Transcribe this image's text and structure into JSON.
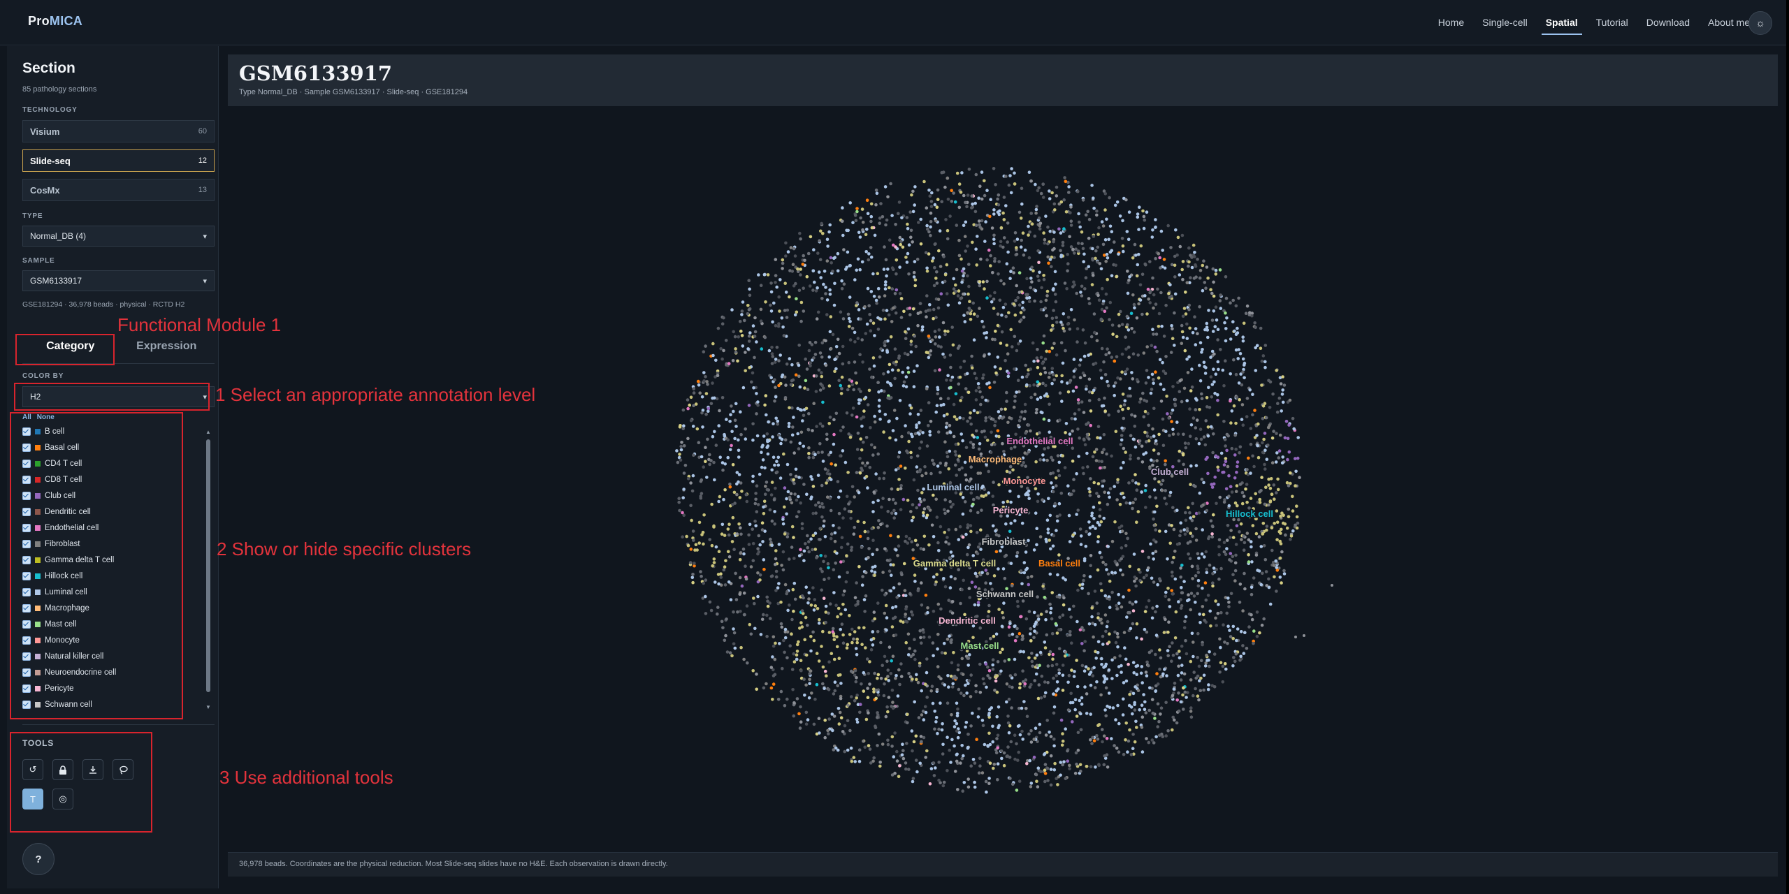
{
  "nav": {
    "brand_part1": "Pro",
    "brand_part2": "MICA",
    "links": [
      "Home",
      "Single-cell",
      "Spatial",
      "Tutorial",
      "Download",
      "About me"
    ],
    "active": "Spatial",
    "theme_icon": "sun-icon"
  },
  "sidebar": {
    "title": "Section",
    "subtitle": "85 pathology sections",
    "technology_label": "TECHNOLOGY",
    "technologies": [
      {
        "name": "Visium",
        "count": "60"
      },
      {
        "name": "Slide-seq",
        "count": "12"
      },
      {
        "name": "CosMx",
        "count": "13"
      }
    ],
    "selected_technology": "Slide-seq",
    "type_label": "TYPE",
    "type_value": "Normal_DB (4)",
    "sample_label": "SAMPLE",
    "sample_value": "GSM6133917",
    "meta": "GSE181294 · 36,978 beads · physical · RCTD H2",
    "tabs": [
      "Category",
      "Expression"
    ],
    "active_tab": "Category",
    "color_by_label": "COLOR BY",
    "color_by_value": "H2",
    "all_label": "All",
    "none_label": "None",
    "clusters": [
      {
        "name": "B cell",
        "color": "#1f77b4"
      },
      {
        "name": "Basal cell",
        "color": "#ff7f0e"
      },
      {
        "name": "CD4 T cell",
        "color": "#2ca02c"
      },
      {
        "name": "CD8 T cell",
        "color": "#d62728"
      },
      {
        "name": "Club cell",
        "color": "#9467bd"
      },
      {
        "name": "Dendritic cell",
        "color": "#8c564b"
      },
      {
        "name": "Endothelial cell",
        "color": "#e377c2"
      },
      {
        "name": "Fibroblast",
        "color": "#7f7f7f"
      },
      {
        "name": "Gamma delta T cell",
        "color": "#bcbd22"
      },
      {
        "name": "Hillock cell",
        "color": "#17becf"
      },
      {
        "name": "Luminal cell",
        "color": "#aec7e8"
      },
      {
        "name": "Macrophage",
        "color": "#ffbb78"
      },
      {
        "name": "Mast cell",
        "color": "#98df8a"
      },
      {
        "name": "Monocyte",
        "color": "#ff9896"
      },
      {
        "name": "Natural killer cell",
        "color": "#c5b0d5"
      },
      {
        "name": "Neuroendocrine cell",
        "color": "#c49c94"
      },
      {
        "name": "Pericyte",
        "color": "#f7b6d2"
      },
      {
        "name": "Schwann cell",
        "color": "#c7c7c7"
      }
    ],
    "tools_label": "TOOLS",
    "tools_row1": [
      "reset-icon",
      "lock-icon",
      "download-icon",
      "lasso-icon"
    ],
    "tools_row2": [
      {
        "icon": "text-icon",
        "glyph": "T"
      },
      {
        "icon": "target-icon",
        "glyph": "◎"
      }
    ],
    "help_label": "?"
  },
  "main": {
    "title": "GSM6133917",
    "subtitle": "Type Normal_DB · Sample GSM6133917 · Slide-seq · GSE181294",
    "footer": "36,978 beads. Coordinates are the physical reduction. Most Slide-seq slides have no H&E. Each observation is drawn directly."
  },
  "plot": {
    "labels": [
      {
        "text": "Endothelial cell",
        "color": "#e377c2"
      },
      {
        "text": "Macrophage",
        "color": "#ffbb78"
      },
      {
        "text": "Luminal cell",
        "color": "#aec7e8"
      },
      {
        "text": "Monocyte",
        "color": "#ff9896"
      },
      {
        "text": "Club cell",
        "color": "#c5b0d5"
      },
      {
        "text": "Hillock cell",
        "color": "#17becf"
      },
      {
        "text": "Pericyte",
        "color": "#f7b6d2"
      },
      {
        "text": "Fibroblast",
        "color": "#c7c7c7"
      },
      {
        "text": "Gamma delta T cell",
        "color": "#dbdb8d"
      },
      {
        "text": "Basal cell",
        "color": "#ff7f0e"
      },
      {
        "text": "Schwann cell",
        "color": "#c7c7c7"
      },
      {
        "text": "Dendritic cell",
        "color": "#f7b6d2"
      },
      {
        "text": "Mast cell",
        "color": "#98df8a"
      }
    ]
  },
  "annotations": {
    "module": "Functional Module 1",
    "step1": "1 Select an appropriate annotation level",
    "step2": "2 Show or hide specific clusters",
    "step3": "3 Use additional tools"
  }
}
